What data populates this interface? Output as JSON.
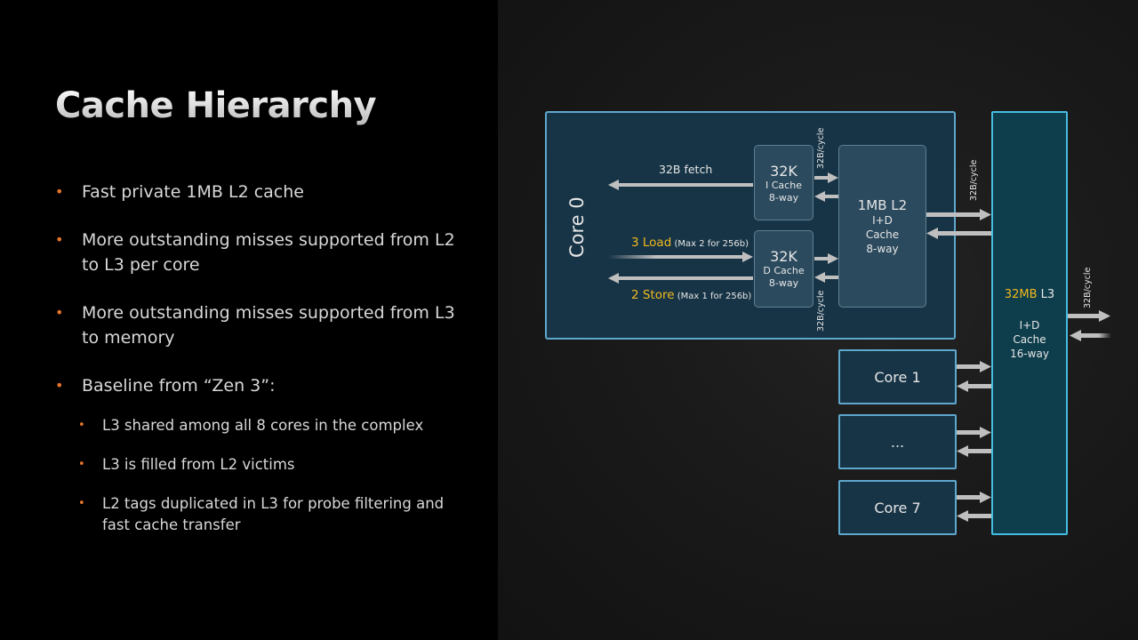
{
  "slide": {
    "title": "Cache Hierarchy",
    "bullets": [
      "Fast private 1MB L2 cache",
      "More outstanding misses supported from L2 to L3 per core",
      "More outstanding misses supported from L3 to memory",
      "Baseline from “Zen 3”:"
    ],
    "sub_bullets": [
      "L3 shared among all 8 cores in the complex",
      "L3 is filled from L2 victims",
      "L2 tags duplicated in L3 for probe filtering and fast cache transfer"
    ]
  },
  "diagram": {
    "core0_label": "Core 0",
    "icache": {
      "size": "32K",
      "name": "I Cache",
      "ways": "8-way"
    },
    "dcache": {
      "size": "32K",
      "name": "D Cache",
      "ways": "8-way"
    },
    "l2": {
      "size": "1MB L2",
      "type": "I+D",
      "name": "Cache",
      "ways": "8-way"
    },
    "l3": {
      "size_highlight": "32MB",
      "size_suffix": " L3",
      "type": "I+D",
      "name": "Cache",
      "ways": "16-way"
    },
    "fetch_label": "32B fetch",
    "load_label": "3 Load",
    "load_note": " (Max 2 for 256b)",
    "store_label": "2 Store",
    "store_note": " (Max 1 for 256b)",
    "bw_label": "32B/cycle",
    "other_cores": [
      "Core 1",
      "...",
      "Core 7"
    ],
    "colors": {
      "accent": "#f2b91c",
      "bullet": "#e8752a",
      "core_border": "#5fa8cd",
      "l3_border": "#45bde0"
    }
  }
}
